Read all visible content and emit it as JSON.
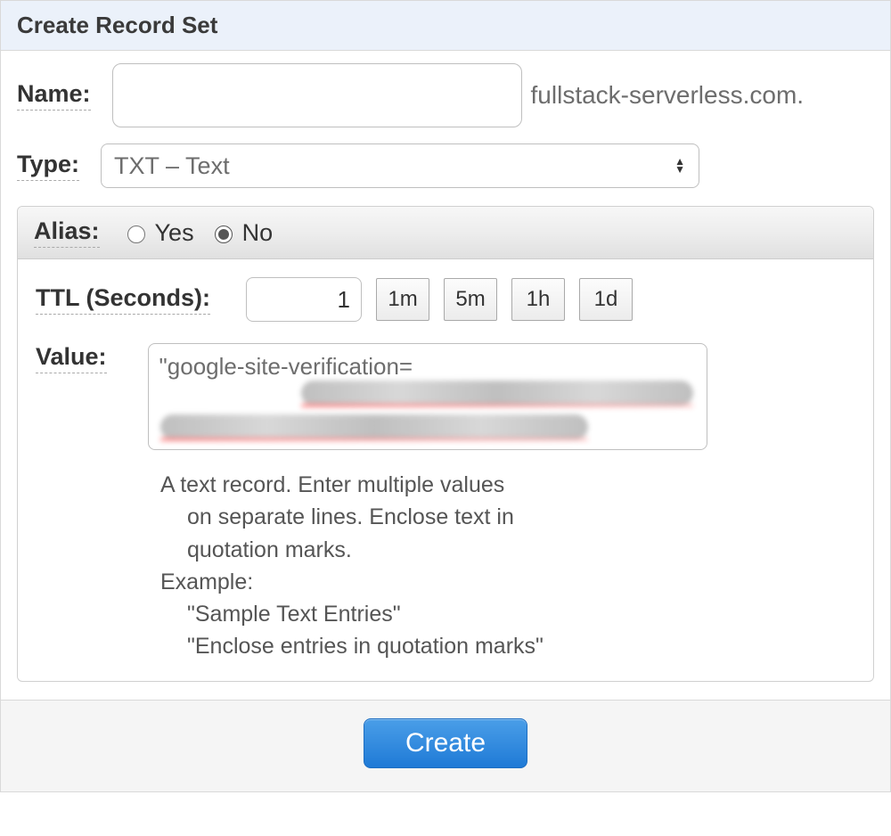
{
  "header": {
    "title": "Create Record Set"
  },
  "name": {
    "label": "Name:",
    "value": "",
    "suffix": "fullstack-serverless.com."
  },
  "type": {
    "label": "Type:",
    "selected": "TXT – Text"
  },
  "alias": {
    "label": "Alias:",
    "options": {
      "yes": "Yes",
      "no": "No"
    },
    "selected": "no"
  },
  "ttl": {
    "label": "TTL (Seconds):",
    "value": "1",
    "presets": [
      "1m",
      "5m",
      "1h",
      "1d"
    ]
  },
  "value": {
    "label": "Value:",
    "text": "\"google-site-verification=",
    "help": {
      "line1": "A text record. Enter multiple values",
      "line2": "on separate lines. Enclose text in",
      "line3": "quotation marks.",
      "example_label": "Example:",
      "example1": "\"Sample Text Entries\"",
      "example2": "\"Enclose entries in quotation marks\""
    }
  },
  "footer": {
    "create": "Create"
  }
}
